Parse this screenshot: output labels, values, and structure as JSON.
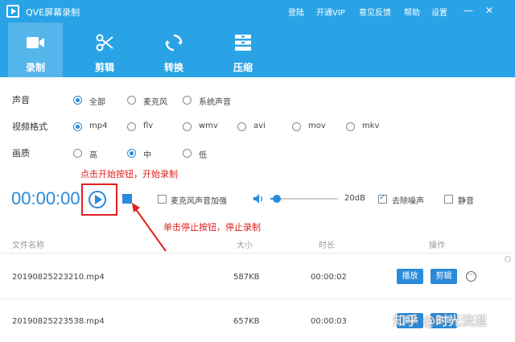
{
  "app": {
    "title": "QVE屏幕录制",
    "menu": [
      "登陆",
      "开通VIP",
      "意见反馈",
      "帮助",
      "设置"
    ]
  },
  "toolbar": {
    "tabs": [
      {
        "label": "录制",
        "icon": "video-camera-icon",
        "active": true
      },
      {
        "label": "剪辑",
        "icon": "scissors-icon",
        "active": false
      },
      {
        "label": "转换",
        "icon": "convert-icon",
        "active": false
      },
      {
        "label": "压缩",
        "icon": "compress-icon",
        "active": false
      }
    ]
  },
  "settings": {
    "sound": {
      "label": "声音",
      "options": [
        "全部",
        "麦克风",
        "系统声音"
      ],
      "selected": "全部"
    },
    "format": {
      "label": "视频格式",
      "options": [
        "mp4",
        "flv",
        "wmv",
        "avi",
        "mov",
        "mkv"
      ],
      "selected": "mp4"
    },
    "quality": {
      "label": "画质",
      "options": [
        "高",
        "中",
        "低"
      ],
      "selected": "中"
    }
  },
  "controls": {
    "timer": "00:00:00",
    "mic_boost_label": "麦克风声音加强",
    "mic_boost_checked": false,
    "volume_level": 0.1,
    "volume_value": "20dB",
    "noise_reduction_label": "去除噪声",
    "noise_reduction_checked": true,
    "mute_label": "静音",
    "mute_checked": false
  },
  "annotations": {
    "start_hint": "点击开始按钮，开始录制",
    "stop_hint": "单击停止按钮，停止录制"
  },
  "file_table": {
    "headers": [
      "文件名称",
      "大小",
      "时长",
      "操作"
    ],
    "rows": [
      {
        "name": "20190825223210.mp4",
        "size": "587KB",
        "duration": "00:00:02",
        "play": "播放",
        "edit": "剪辑"
      },
      {
        "name": "20190825223538.mp4",
        "size": "657KB",
        "duration": "00:00:03",
        "play": "播放",
        "edit": "剪辑"
      }
    ]
  },
  "watermark": "知乎 @时光流逝",
  "colors": {
    "accent": "#2aa3e6",
    "primary": "#2a8ad8",
    "annotation": "#e02020"
  }
}
